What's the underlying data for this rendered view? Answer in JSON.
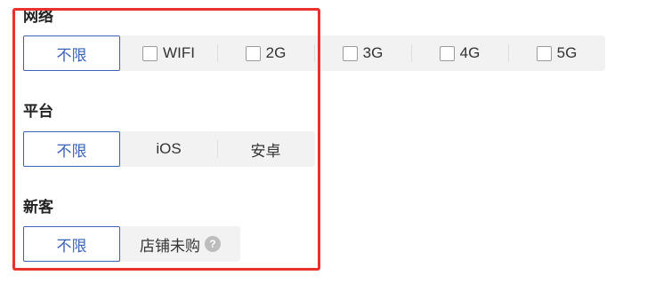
{
  "network": {
    "title": "网络",
    "options": [
      "不限",
      "WIFI",
      "2G",
      "3G",
      "4G",
      "5G"
    ]
  },
  "platform": {
    "title": "平台",
    "options": [
      "不限",
      "iOS",
      "安卓"
    ]
  },
  "new_customer": {
    "title": "新客",
    "options": [
      "不限",
      "店铺未购"
    ],
    "help_glyph": "?"
  },
  "colors": {
    "active_border": "#3a63b8",
    "segment_bg": "#f2f2f2",
    "highlight_border": "#e8322b"
  },
  "icons": {
    "checkbox": "checkbox-icon",
    "help": "help-icon"
  }
}
